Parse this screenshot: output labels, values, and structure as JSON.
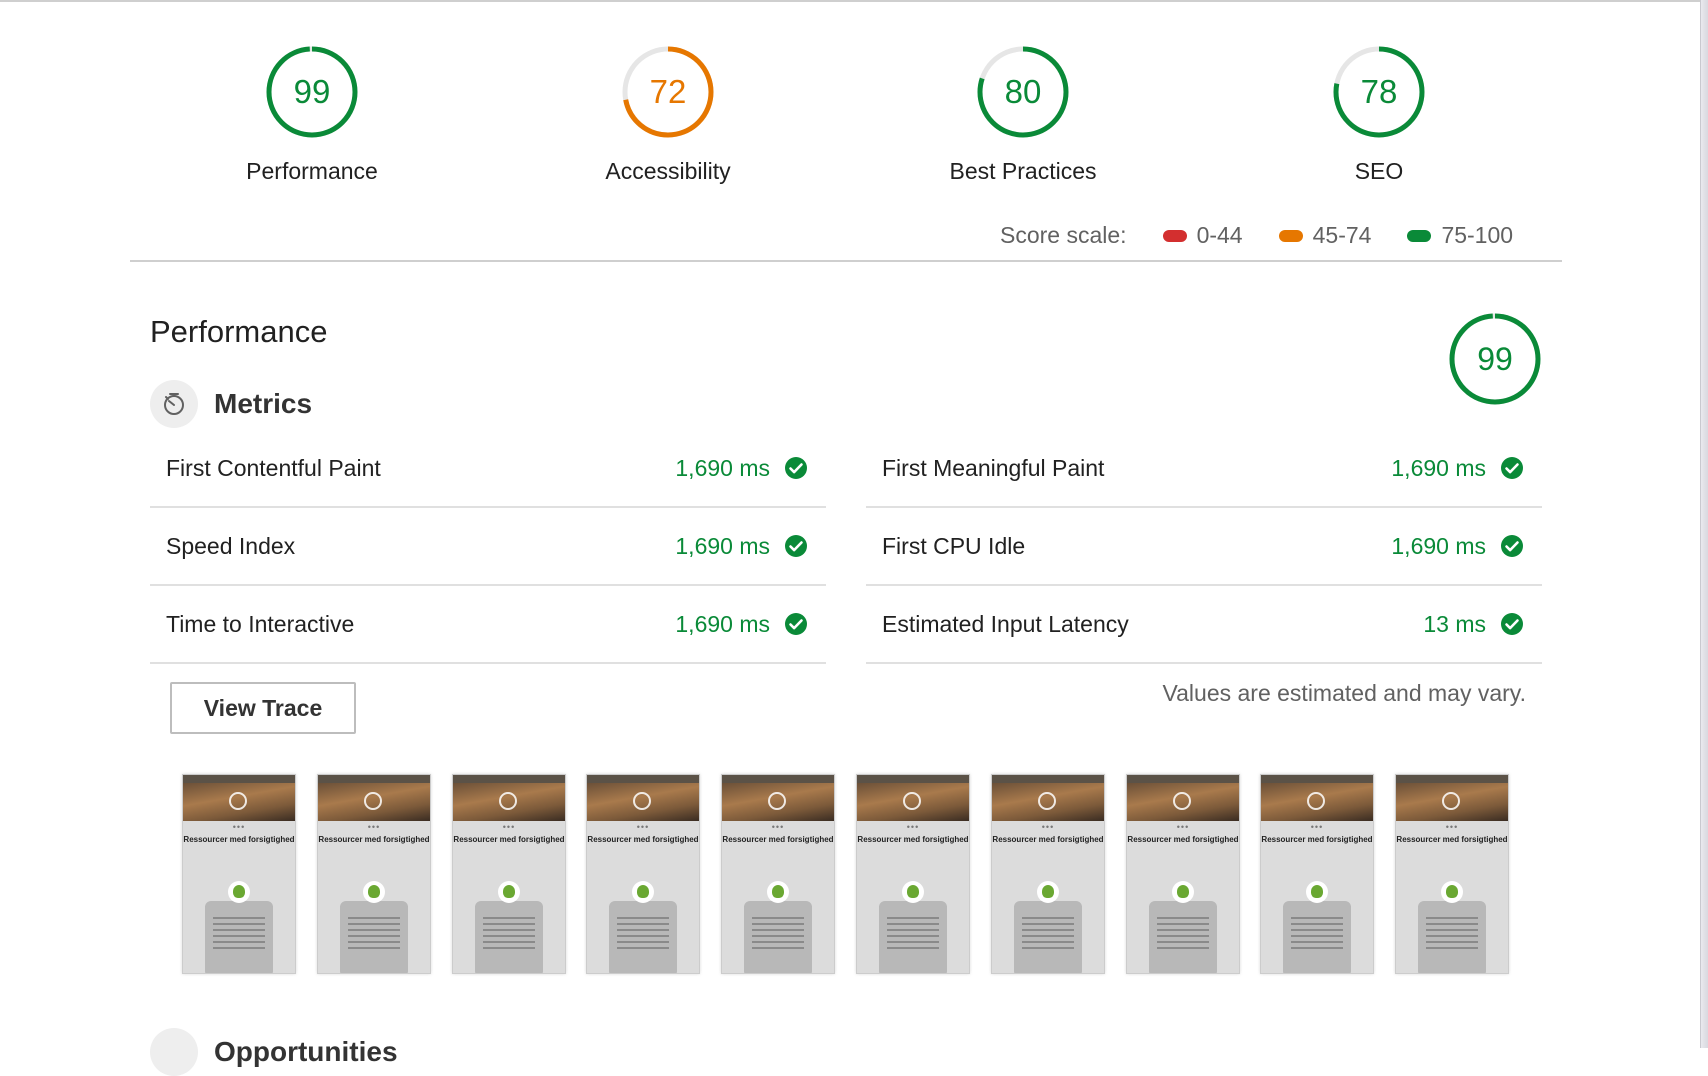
{
  "colors": {
    "pass": "#0a8a38",
    "average": "#e67700",
    "fail": "#d32f2f",
    "track": "#e6e6e6"
  },
  "gauges": [
    {
      "score": "99",
      "value": 99,
      "label": "Performance",
      "status": "pass"
    },
    {
      "score": "72",
      "value": 72,
      "label": "Accessibility",
      "status": "average"
    },
    {
      "score": "80",
      "value": 80,
      "label": "Best Practices",
      "status": "pass"
    },
    {
      "score": "78",
      "value": 78,
      "label": "SEO",
      "status": "pass"
    }
  ],
  "score_scale": {
    "label": "Score scale:",
    "ranges": [
      "0-44",
      "45-74",
      "75-100"
    ]
  },
  "performance": {
    "title": "Performance",
    "score": "99",
    "value": 99
  },
  "metrics": {
    "title": "Metrics",
    "icon": "timer-icon",
    "items": [
      {
        "label": "First Contentful Paint",
        "value": "1,690 ms"
      },
      {
        "label": "First Meaningful Paint",
        "value": "1,690 ms"
      },
      {
        "label": "Speed Index",
        "value": "1,690 ms"
      },
      {
        "label": "First CPU Idle",
        "value": "1,690 ms"
      },
      {
        "label": "Time to Interactive",
        "value": "1,690 ms"
      },
      {
        "label": "Estimated Input Latency",
        "value": "13 ms"
      }
    ],
    "view_trace_label": "View Trace",
    "note": "Values are estimated and may vary."
  },
  "filmstrip": {
    "frame_title": "Ressourcer med forsigtighed",
    "frame_count": 10
  },
  "opportunities": {
    "title": "Opportunities"
  }
}
